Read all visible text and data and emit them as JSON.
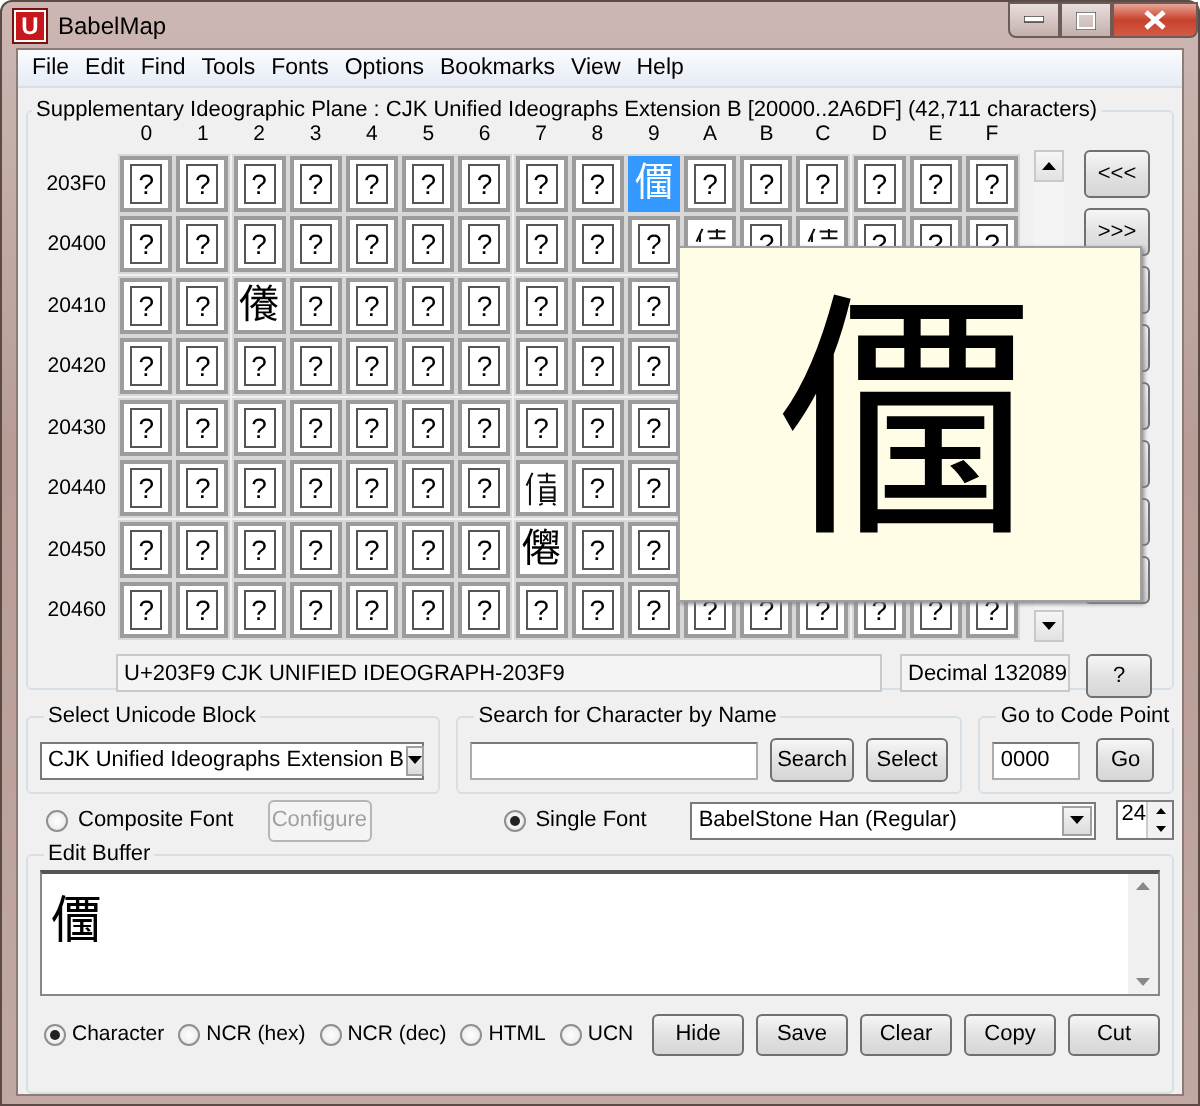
{
  "window": {
    "title": "BabelMap",
    "icon_letter": "U"
  },
  "menu": [
    "File",
    "Edit",
    "Find",
    "Tools",
    "Fonts",
    "Options",
    "Bookmarks",
    "View",
    "Help"
  ],
  "char_table": {
    "title": "Supplementary Ideographic Plane : CJK Unified Ideographs Extension B [20000..2A6DF] (42,711 characters)",
    "columns": [
      "0",
      "1",
      "2",
      "3",
      "4",
      "5",
      "6",
      "7",
      "8",
      "9",
      "A",
      "B",
      "C",
      "D",
      "E",
      "F"
    ],
    "rows": [
      {
        "label": "203F0",
        "cells": [
          {
            "glyph": "?",
            "missing": true,
            "selected": false
          },
          {
            "glyph": "?",
            "missing": true,
            "selected": false
          },
          {
            "glyph": "?",
            "missing": true,
            "selected": false
          },
          {
            "glyph": "?",
            "missing": true,
            "selected": false
          },
          {
            "glyph": "?",
            "missing": true,
            "selected": false
          },
          {
            "glyph": "?",
            "missing": true,
            "selected": false
          },
          {
            "glyph": "?",
            "missing": true,
            "selected": false
          },
          {
            "glyph": "?",
            "missing": true,
            "selected": false
          },
          {
            "glyph": "?",
            "missing": true,
            "selected": false
          },
          {
            "glyph": "𠏹",
            "missing": false,
            "selected": true
          },
          {
            "glyph": "?",
            "missing": true,
            "selected": false
          },
          {
            "glyph": "?",
            "missing": true,
            "selected": false
          },
          {
            "glyph": "?",
            "missing": true,
            "selected": false
          },
          {
            "glyph": "?",
            "missing": true,
            "selected": false
          },
          {
            "glyph": "?",
            "missing": true,
            "selected": false
          },
          {
            "glyph": "?",
            "missing": true,
            "selected": false
          }
        ]
      },
      {
        "label": "20400",
        "cells": [
          {
            "glyph": "?",
            "missing": true,
            "selected": false
          },
          {
            "glyph": "?",
            "missing": true,
            "selected": false
          },
          {
            "glyph": "?",
            "missing": true,
            "selected": false
          },
          {
            "glyph": "?",
            "missing": true,
            "selected": false
          },
          {
            "glyph": "?",
            "missing": true,
            "selected": false
          },
          {
            "glyph": "?",
            "missing": true,
            "selected": false
          },
          {
            "glyph": "?",
            "missing": true,
            "selected": false
          },
          {
            "glyph": "?",
            "missing": true,
            "selected": false
          },
          {
            "glyph": "?",
            "missing": true,
            "selected": false
          },
          {
            "glyph": "?",
            "missing": true,
            "selected": false
          },
          {
            "kind": "covered",
            "missing": false,
            "selected": false
          },
          {
            "glyph": "?",
            "missing": true,
            "selected": false
          },
          {
            "kind": "covered",
            "missing": false,
            "selected": false
          },
          {
            "glyph": "?",
            "missing": true,
            "selected": false
          },
          {
            "glyph": "?",
            "missing": true,
            "selected": false
          },
          {
            "glyph": "?",
            "missing": true,
            "selected": false
          }
        ]
      },
      {
        "label": "20410",
        "cells": [
          {
            "glyph": "?",
            "missing": true,
            "selected": false
          },
          {
            "glyph": "?",
            "missing": true,
            "selected": false
          },
          {
            "glyph": "𠐒",
            "missing": false,
            "selected": false
          },
          {
            "glyph": "?",
            "missing": true,
            "selected": false
          },
          {
            "glyph": "?",
            "missing": true,
            "selected": false
          },
          {
            "glyph": "?",
            "missing": true,
            "selected": false
          },
          {
            "glyph": "?",
            "missing": true,
            "selected": false
          },
          {
            "glyph": "?",
            "missing": true,
            "selected": false
          },
          {
            "glyph": "?",
            "missing": true,
            "selected": false
          },
          {
            "glyph": "?",
            "missing": true,
            "selected": false
          }
        ]
      },
      {
        "label": "20420",
        "cells": [
          {
            "glyph": "?",
            "missing": true,
            "selected": false
          },
          {
            "glyph": "?",
            "missing": true,
            "selected": false
          },
          {
            "glyph": "?",
            "missing": true,
            "selected": false
          },
          {
            "glyph": "?",
            "missing": true,
            "selected": false
          },
          {
            "glyph": "?",
            "missing": true,
            "selected": false
          },
          {
            "glyph": "?",
            "missing": true,
            "selected": false
          },
          {
            "glyph": "?",
            "missing": true,
            "selected": false
          },
          {
            "glyph": "?",
            "missing": true,
            "selected": false
          },
          {
            "glyph": "?",
            "missing": true,
            "selected": false
          },
          {
            "glyph": "?",
            "missing": true,
            "selected": false
          }
        ]
      },
      {
        "label": "20430",
        "cells": [
          {
            "glyph": "?",
            "missing": true,
            "selected": false
          },
          {
            "glyph": "?",
            "missing": true,
            "selected": false
          },
          {
            "glyph": "?",
            "missing": true,
            "selected": false
          },
          {
            "glyph": "?",
            "missing": true,
            "selected": false
          },
          {
            "glyph": "?",
            "missing": true,
            "selected": false
          },
          {
            "glyph": "?",
            "missing": true,
            "selected": false
          },
          {
            "glyph": "?",
            "missing": true,
            "selected": false
          },
          {
            "glyph": "?",
            "missing": true,
            "selected": false
          },
          {
            "glyph": "?",
            "missing": true,
            "selected": false
          },
          {
            "glyph": "?",
            "missing": true,
            "selected": false
          }
        ]
      },
      {
        "label": "20440",
        "cells": [
          {
            "glyph": "?",
            "missing": true,
            "selected": false
          },
          {
            "glyph": "?",
            "missing": true,
            "selected": false
          },
          {
            "glyph": "?",
            "missing": true,
            "selected": false
          },
          {
            "glyph": "?",
            "missing": true,
            "selected": false
          },
          {
            "glyph": "?",
            "missing": true,
            "selected": false
          },
          {
            "glyph": "?",
            "missing": true,
            "selected": false
          },
          {
            "glyph": "?",
            "missing": true,
            "selected": false
          },
          {
            "missing": false,
            "selected": false
          },
          {
            "glyph": "?",
            "missing": true,
            "selected": false
          },
          {
            "glyph": "?",
            "missing": true,
            "selected": false
          }
        ]
      },
      {
        "label": "20450",
        "cells": [
          {
            "glyph": "?",
            "missing": true,
            "selected": false
          },
          {
            "glyph": "?",
            "missing": true,
            "selected": false
          },
          {
            "glyph": "?",
            "missing": true,
            "selected": false
          },
          {
            "glyph": "?",
            "missing": true,
            "selected": false
          },
          {
            "glyph": "?",
            "missing": true,
            "selected": false
          },
          {
            "glyph": "?",
            "missing": true,
            "selected": false
          },
          {
            "glyph": "?",
            "missing": true,
            "selected": false
          },
          {
            "glyph": "𠑗",
            "missing": false,
            "selected": false
          },
          {
            "glyph": "?",
            "missing": true,
            "selected": false
          },
          {
            "glyph": "?",
            "missing": true,
            "selected": false
          }
        ]
      },
      {
        "label": "20460",
        "cells": [
          {
            "glyph": "?",
            "missing": true,
            "selected": false
          },
          {
            "glyph": "?",
            "missing": true,
            "selected": false
          },
          {
            "glyph": "?",
            "missing": true,
            "selected": false
          },
          {
            "glyph": "?",
            "missing": true,
            "selected": false
          },
          {
            "glyph": "?",
            "missing": true,
            "selected": false
          },
          {
            "glyph": "?",
            "missing": true,
            "selected": false
          },
          {
            "glyph": "?",
            "missing": true,
            "selected": false
          },
          {
            "glyph": "?",
            "missing": true,
            "selected": false
          },
          {
            "glyph": "?",
            "missing": true,
            "selected": false
          },
          {
            "glyph": "?",
            "missing": true,
            "selected": false
          },
          {
            "glyph": "?",
            "missing": true,
            "selected": false
          },
          {
            "glyph": "?",
            "missing": true,
            "selected": false
          },
          {
            "glyph": "?",
            "missing": true,
            "selected": false
          },
          {
            "glyph": "?",
            "missing": true,
            "selected": false
          },
          {
            "glyph": "?",
            "missing": true,
            "selected": false
          },
          {
            "glyph": "?",
            "missing": true,
            "selected": false
          }
        ]
      }
    ],
    "nav_buttons": [
      "<<<",
      ">>>"
    ],
    "popup": {
      "glyph": "𠏹"
    },
    "name_field": "U+203F9 CJK UNIFIED IDEOGRAPH-203F9",
    "decimal_field": "Decimal 132089",
    "help_button": "?"
  },
  "unicode_block": {
    "label": "Select Unicode Block",
    "value": "CJK Unified Ideographs Extension B"
  },
  "search": {
    "label": "Search for Character by Name",
    "buttons": [
      "Search",
      "Select"
    ]
  },
  "go_to": {
    "label": "Go to Code Point",
    "value": "0000",
    "button": "Go"
  },
  "font_modes": [
    {
      "label": "Composite Font",
      "selected": false
    },
    {
      "label": "Single Font",
      "selected": true
    }
  ],
  "configure_button": {
    "label": "Configure",
    "disabled": true
  },
  "font": {
    "value": "BabelStone Han (Regular)",
    "size": "24"
  },
  "edit_buffer": {
    "label": "Edit Buffer",
    "text": "𠏹",
    "formats": [
      {
        "label": "Character",
        "selected": true
      },
      {
        "label": "NCR (hex)",
        "selected": false
      },
      {
        "label": "NCR (dec)",
        "selected": false
      },
      {
        "label": "HTML",
        "selected": false
      },
      {
        "label": "UCN",
        "selected": false
      }
    ],
    "buttons": [
      "Hide",
      "Save",
      "Clear",
      "Copy",
      "Cut"
    ]
  }
}
